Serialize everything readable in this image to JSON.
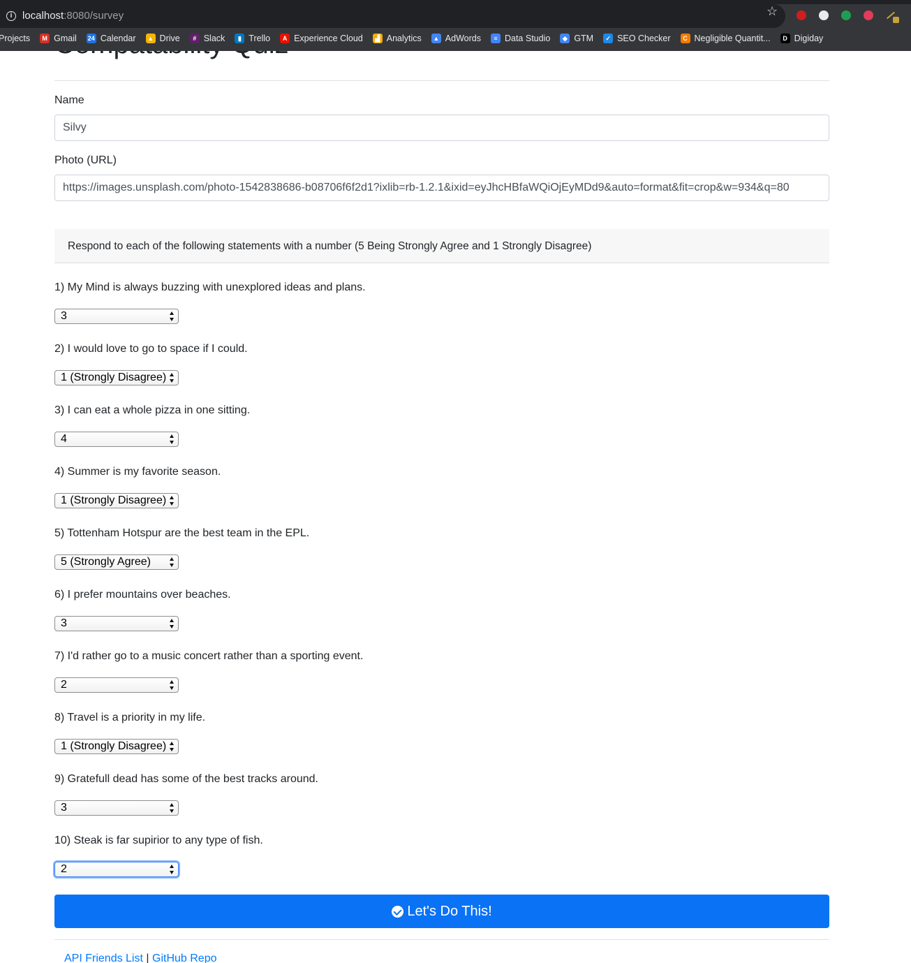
{
  "browser": {
    "url_host": "localhost",
    "url_rest": ":8080/survey",
    "bookmarks": [
      {
        "label": "Projects",
        "color": "#35363a",
        "glyph": ""
      },
      {
        "label": "Gmail",
        "color": "#d93025",
        "glyph": "M"
      },
      {
        "label": "Calendar",
        "color": "#1a73e8",
        "glyph": "24"
      },
      {
        "label": "Drive",
        "color": "#f4b400",
        "glyph": "▲"
      },
      {
        "label": "Slack",
        "color": "#611f69",
        "glyph": "#"
      },
      {
        "label": "Trello",
        "color": "#0079bf",
        "glyph": "▮"
      },
      {
        "label": "Experience Cloud",
        "color": "#eb1000",
        "glyph": "A"
      },
      {
        "label": "Analytics",
        "color": "#f9ab00",
        "glyph": "▟"
      },
      {
        "label": "AdWords",
        "color": "#4285f4",
        "glyph": "▲"
      },
      {
        "label": "Data Studio",
        "color": "#4285f4",
        "glyph": "≡"
      },
      {
        "label": "GTM",
        "color": "#4285f4",
        "glyph": "◆"
      },
      {
        "label": "SEO Checker",
        "color": "#1e88e5",
        "glyph": "✓"
      },
      {
        "label": "Negligible Quantit...",
        "color": "#f57c00",
        "glyph": "C"
      },
      {
        "label": "Digiday",
        "color": "#000000",
        "glyph": "D"
      }
    ]
  },
  "page": {
    "title": "Compatability Quiz",
    "name_label": "Name",
    "name_value": "Silvy",
    "photo_label": "Photo (URL)",
    "photo_value": "https://images.unsplash.com/photo-1542838686-b08706f6f2d1?ixlib=rb-1.2.1&ixid=eyJhcHBfaWQiOjEyMDd9&auto=format&fit=crop&w=934&q=80",
    "instructions": "Respond to each of the following statements with a number (5 Being Strongly Agree and 1 Strongly Disagree)",
    "questions": [
      {
        "text": "1) My Mind is always buzzing with unexplored ideas and plans.",
        "answer": "3"
      },
      {
        "text": "2) I would love to go to space if I could.",
        "answer": "1 (Strongly Disagree)"
      },
      {
        "text": "3) I can eat a whole pizza in one sitting.",
        "answer": "4"
      },
      {
        "text": "4) Summer is my favorite season.",
        "answer": "1 (Strongly Disagree)"
      },
      {
        "text": "5) Tottenham Hotspur are the best team in the EPL.",
        "answer": "5 (Strongly Agree)"
      },
      {
        "text": "6) I prefer mountains over beaches.",
        "answer": "3"
      },
      {
        "text": "7) I'd rather go to a music concert rather than a sporting event.",
        "answer": "2"
      },
      {
        "text": "8) Travel is a priority in my life.",
        "answer": "1 (Strongly Disagree)"
      },
      {
        "text": "9) Gratefull dead has some of the best tracks around.",
        "answer": "3"
      },
      {
        "text": "10) Steak is far supirior to any type of fish.",
        "answer": "2"
      }
    ],
    "submit_label": "Let's Do This!",
    "footer": {
      "link1": "API Friends List",
      "separator": "|",
      "link2": "GitHub Repo"
    },
    "accent_color": "#0a72f5"
  }
}
